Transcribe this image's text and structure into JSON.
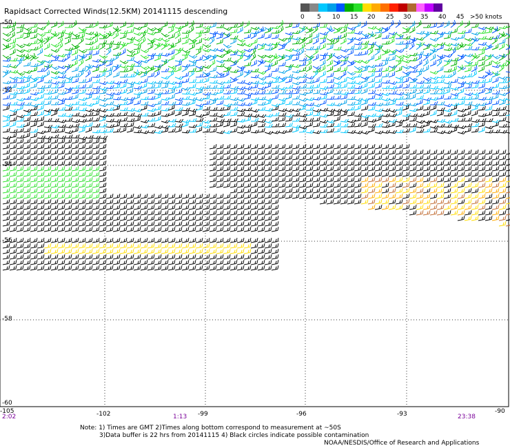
{
  "title": "Rapidsact Corrected Winds(12.5KM) 20141115 descending",
  "scale": {
    "labels": [
      "0",
      "5",
      "10",
      "15",
      "20",
      "25",
      "30",
      "35",
      "40",
      "45",
      ">50 knots"
    ],
    "colors": [
      "#555555",
      "#888888",
      "#00c8ff",
      "#00a0e8",
      "#0055ff",
      "#00b000",
      "#28e028",
      "#ffdd00",
      "#ffaa00",
      "#ff7000",
      "#ff2000",
      "#c00000",
      "#b06a30",
      "#ff60ff",
      "#c000ff",
      "#6000a0"
    ]
  },
  "axes": {
    "lat_labels": [
      "-50",
      "-52",
      "-54",
      "-56",
      "-58",
      "-60"
    ],
    "lon_labels": [
      "-105",
      "-102",
      "-99",
      "-96",
      "-93",
      "-90"
    ]
  },
  "times": {
    "t1": "2:02",
    "t2": "1:13",
    "t3": "23:38"
  },
  "notes": {
    "line1": "Note: 1) Times are GMT 2)Times along bottom correspond to measurement at ~50S",
    "line2": "3)Data buffer is 22 hrs from 20141115 4) Black circles indicate possible contamination",
    "credit": "NOAA/NESDIS/Office of Research and Applications"
  }
}
